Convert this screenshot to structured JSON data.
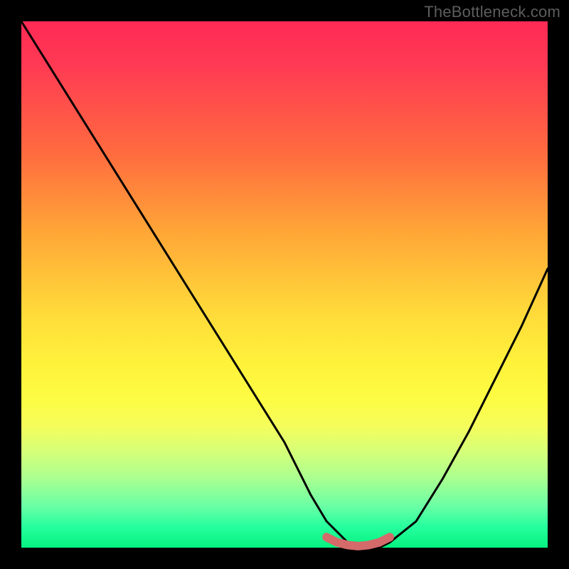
{
  "watermark": "TheBottleneck.com",
  "chart_data": {
    "type": "line",
    "title": "",
    "xlabel": "",
    "ylabel": "",
    "xlim": [
      0,
      100
    ],
    "ylim": [
      0,
      100
    ],
    "series": [
      {
        "name": "bottleneck-curve",
        "x": [
          0,
          10,
          20,
          30,
          40,
          50,
          55,
          58,
          62,
          65,
          68,
          70,
          75,
          80,
          85,
          90,
          95,
          100
        ],
        "values": [
          100,
          84,
          68,
          52,
          36,
          20,
          10,
          5,
          1,
          0,
          0,
          1,
          5,
          13,
          22,
          32,
          42,
          53
        ]
      },
      {
        "name": "flat-marker",
        "x": [
          58,
          60,
          62,
          64,
          66,
          68,
          70
        ],
        "values": [
          2,
          1,
          0.5,
          0.3,
          0.5,
          1,
          2
        ]
      }
    ],
    "colors": {
      "curve": "#000000",
      "flat_marker": "#d46a6a",
      "gradient_top": "#ff2a55",
      "gradient_mid": "#fff23b",
      "gradient_bottom": "#05f17f"
    }
  }
}
